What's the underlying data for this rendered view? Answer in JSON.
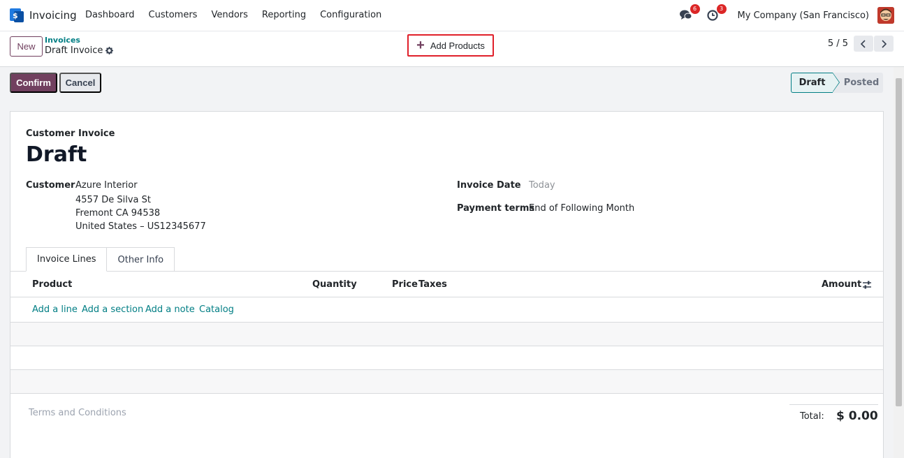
{
  "navbar": {
    "app_name": "Invoicing",
    "menu": [
      "Dashboard",
      "Customers",
      "Vendors",
      "Reporting",
      "Configuration"
    ],
    "messages_count": "6",
    "activities_count": "3",
    "company": "My Company (San Francisco)"
  },
  "control": {
    "new_label": "New",
    "breadcrumb_parent": "Invoices",
    "breadcrumb_current": "Draft Invoice",
    "add_products_label": "Add Products",
    "pager": "5 / 5"
  },
  "actions": {
    "confirm_label": "Confirm",
    "cancel_label": "Cancel",
    "status": [
      "Draft",
      "Posted"
    ]
  },
  "invoice": {
    "type": "Customer Invoice",
    "title": "Draft",
    "customer_label": "Customer",
    "customer_name": "Azure Interior",
    "address_line1": "4557 De Silva St",
    "address_line2": "Fremont CA 94538",
    "address_line3": "United States – US12345677",
    "invoice_date_label": "Invoice Date",
    "invoice_date_placeholder": "Today",
    "payment_terms_label": "Payment terms",
    "payment_terms_value": "End of Following Month"
  },
  "tabs": [
    "Invoice Lines",
    "Other Info"
  ],
  "lines_table": {
    "columns": [
      "Product",
      "Quantity",
      "Price",
      "Taxes",
      "Amount"
    ],
    "adders": [
      "Add a line",
      "Add a section",
      "Add a note",
      "Catalog"
    ]
  },
  "footer": {
    "terms_placeholder": "Terms and Conditions",
    "total_label": "Total:",
    "total_value": "$ 0.00"
  },
  "colors": {
    "brand": "#71405f",
    "link": "#017e84",
    "highlight": "#e0202a"
  }
}
